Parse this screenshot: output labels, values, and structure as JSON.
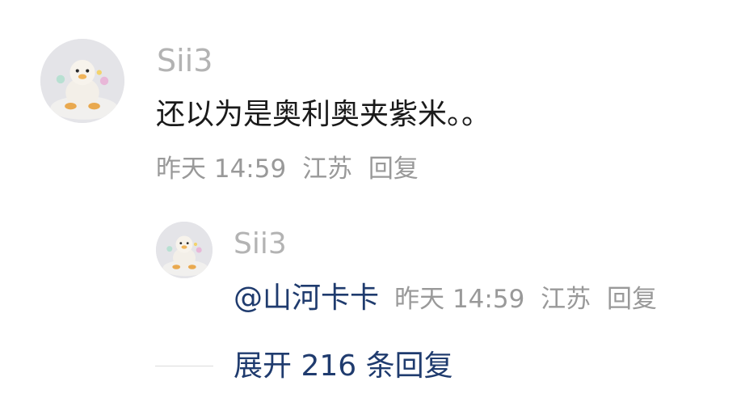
{
  "comment": {
    "username": "Sii3",
    "text": "还以为是奥利奥夹紫米。。",
    "time": "昨天 14:59",
    "location": "江苏",
    "reply_label": "回复"
  },
  "reply": {
    "username": "Sii3",
    "mention": "@山河卡卡",
    "time": "昨天 14:59",
    "location": "江苏",
    "reply_label": "回复"
  },
  "expand": {
    "label": "展开 216 条回复"
  },
  "avatar_icon": "duck-plush-photo",
  "colors": {
    "username": "#b3b3b3",
    "body_text": "#1a1a1a",
    "meta": "#999999",
    "link": "#1f3b6e",
    "divider": "#dcdcdc"
  }
}
